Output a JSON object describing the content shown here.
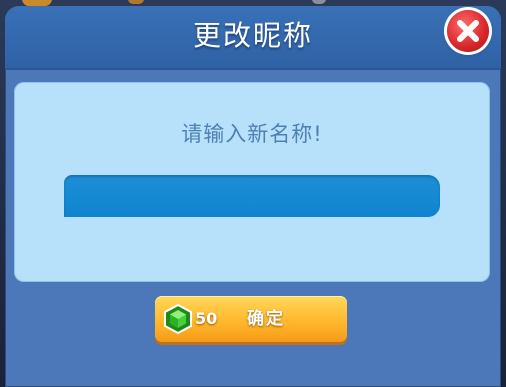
{
  "dialog": {
    "title": "更改昵称",
    "close_icon": "close-x-icon"
  },
  "panel": {
    "prompt": "请输入新名称!",
    "name_input": {
      "value": "",
      "placeholder": ""
    }
  },
  "confirm": {
    "currency_icon": "green-gem-icon",
    "cost": "50",
    "label": "确定"
  },
  "colors": {
    "dialog_bg": "#4c77b8",
    "title_bar": "#3970b6",
    "panel_bg": "#b7e0fb",
    "input_bg": "#1d8fd6",
    "close_red": "#d8262a",
    "confirm_orange": "#ffb52a",
    "gem_green": "#3cbf2a"
  }
}
